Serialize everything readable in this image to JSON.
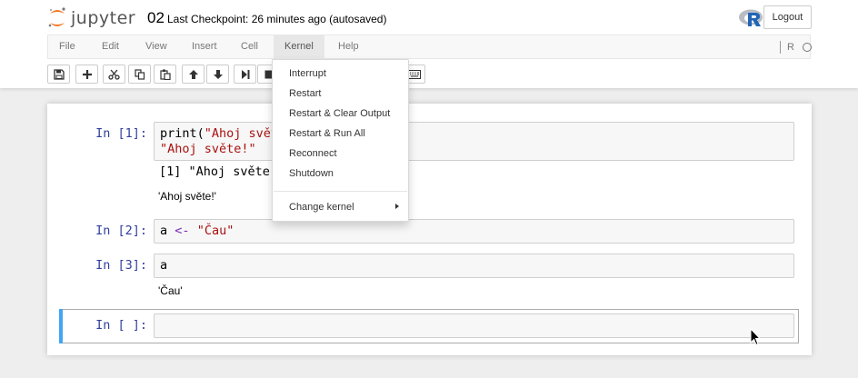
{
  "header": {
    "logo_text": "jupyter",
    "notebook_name": "02",
    "checkpoint": "Last Checkpoint: 26 minutes ago (autosaved)",
    "logout_label": "Logout",
    "kernel_indicator": "R"
  },
  "menubar": {
    "items": [
      "File",
      "Edit",
      "View",
      "Insert",
      "Cell",
      "Kernel",
      "Help"
    ],
    "active": "Kernel"
  },
  "toolbar": {
    "buttons": [
      "save-icon",
      "plus-icon",
      "scissors-icon",
      "copy-icon",
      "paste-icon",
      "arrow-up-icon",
      "arrow-down-icon",
      "run-icon",
      "stop-icon",
      "keyboard-icon"
    ]
  },
  "kernel_menu": {
    "items": [
      "Interrupt",
      "Restart",
      "Restart & Clear Output",
      "Restart & Run All",
      "Reconnect",
      "Shutdown"
    ],
    "submenu": "Change kernel"
  },
  "cells": [
    {
      "prompt": "In [1]:",
      "code_line1_fn": "print(",
      "code_line1_str": "\"Ahoj svět",
      "code_line2_str": "\"Ahoj světe!\"",
      "output_stream": "[1] \"Ahoj světe!",
      "output_result": "'Ahoj světe!'"
    },
    {
      "prompt": "In [2]:",
      "code_var": "a",
      "code_op": "<-",
      "code_str": "\"Čau\""
    },
    {
      "prompt": "In [3]:",
      "code": "a",
      "output_result": "'Čau'"
    },
    {
      "prompt": "In [ ]:",
      "code": ""
    }
  ],
  "colors": {
    "prompt": "#303f9f",
    "string": "#aa1111",
    "operator": "#7a28b8",
    "selected_cell_bar": "#42a5f5",
    "logo_orange": "#f37626"
  }
}
